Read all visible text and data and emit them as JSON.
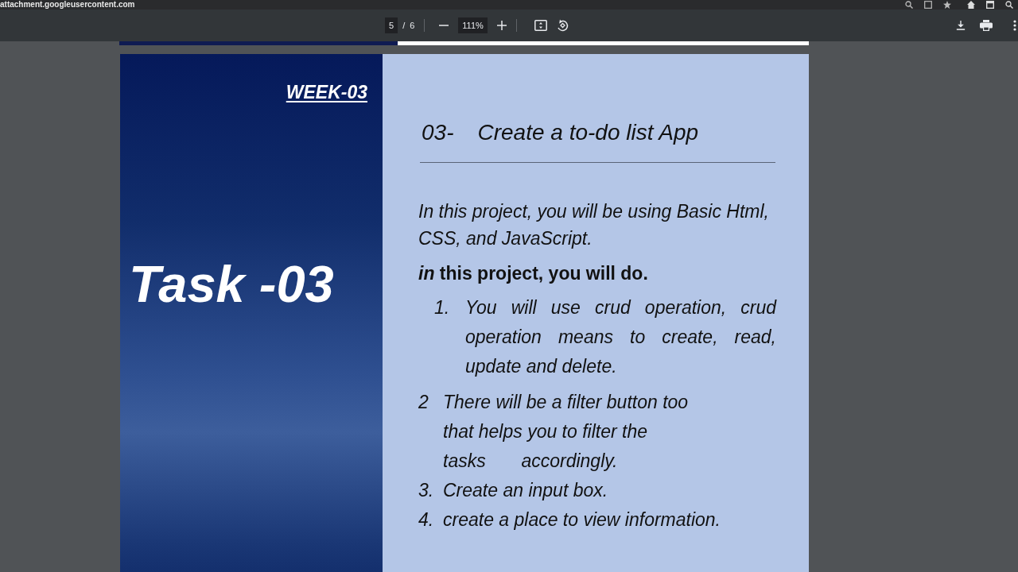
{
  "browser": {
    "url": "attachment.googleusercontent.com"
  },
  "toolbar": {
    "page": "5",
    "separator": "/",
    "page_count": "6",
    "zoom": "111%"
  },
  "slide": {
    "week": "WEEK-03",
    "task": "Task -03",
    "number": "03-",
    "title": "Create a to-do list App",
    "intro": "In this project, you will be using Basic Html, CSS, and JavaScript.",
    "lead": "*in* this project, you will do.",
    "items": [
      {
        "kind": "indented",
        "number": "1.",
        "text": "You will use crud operation, crud operation means to create, read, update and delete."
      },
      {
        "kind": "flush",
        "number": "2",
        "text": "There will be a filter button too\nthat helps you to filter the\ntasks       accordingly."
      },
      {
        "kind": "flush",
        "number": "3.",
        "text": "Create an input box."
      },
      {
        "kind": "flush",
        "number": "4.",
        "text": "create a place to view information."
      }
    ]
  }
}
